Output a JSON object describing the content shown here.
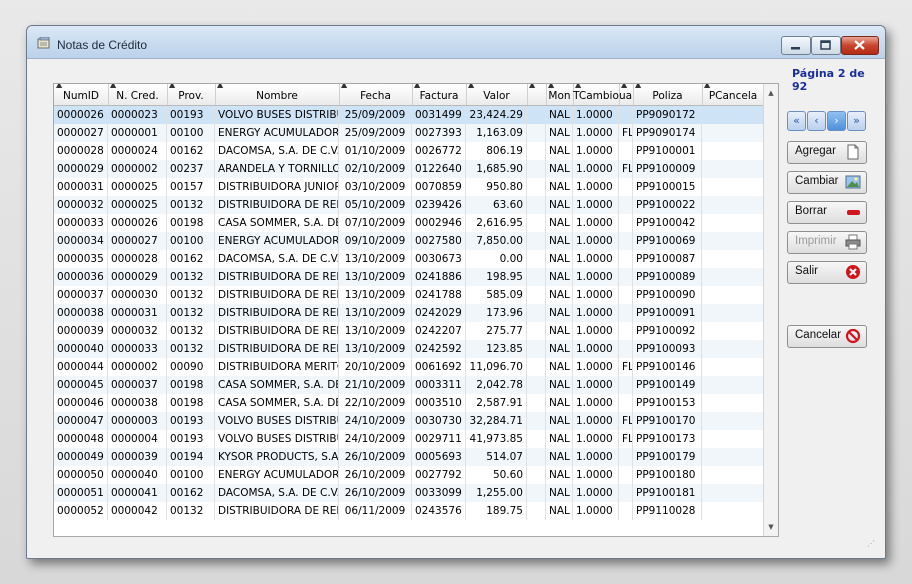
{
  "window": {
    "title": "Notas de Crédito",
    "minimize_icon": "minimize-icon",
    "maximize_icon": "maximize-icon",
    "close_icon": "close-icon"
  },
  "pager": {
    "label": "Página 2 de 92",
    "first_icon": "double-chevron-left-icon",
    "prev_icon": "chevron-left-icon",
    "next_icon": "chevron-right-icon",
    "last_icon": "double-chevron-right-icon"
  },
  "actions": {
    "agregar": {
      "label": "Agregar",
      "icon": "new-document-icon"
    },
    "cambiar": {
      "label": "Cambiar",
      "icon": "edit-picture-icon"
    },
    "borrar": {
      "label": "Borrar",
      "icon": "minus-icon",
      "color": "#d2141b"
    },
    "imprimir": {
      "label": "Imprimir",
      "icon": "printer-icon"
    },
    "salir": {
      "label": "Salir",
      "icon": "exit-x-icon",
      "color": "#d2141b"
    },
    "cancelar": {
      "label": "Cancelar",
      "icon": "cancel-icon",
      "color": "#d2141b"
    }
  },
  "table": {
    "columns": [
      "NumID",
      "N. Cred.",
      "Prov.",
      "Nombre",
      "Fecha",
      "Factura",
      "Valor",
      "",
      "Mon",
      "TCambio",
      "uai",
      "Poliza",
      "PCancela"
    ],
    "rows": [
      [
        "0000026",
        "0000023",
        "00193",
        "VOLVO BUSES DISTRIBUI",
        "25/09/2009",
        "0031499",
        "23,424.29",
        "",
        "NAL",
        "1.0000",
        "",
        "PP9090172",
        ""
      ],
      [
        "0000027",
        "0000001",
        "00100",
        "ENERGY ACUMULADORES",
        "25/09/2009",
        "0027393",
        "1,163.09",
        "",
        "NAL",
        "1.0000",
        "FL",
        "PP9090174",
        ""
      ],
      [
        "0000028",
        "0000024",
        "00162",
        "DACOMSA, S.A. DE C.V.",
        "01/10/2009",
        "0026772",
        "806.19",
        "",
        "NAL",
        "1.0000",
        "",
        "PP9100001",
        ""
      ],
      [
        "0000029",
        "0000002",
        "00237",
        "ARANDELA Y TORNILLOS",
        "02/10/2009",
        "0122640",
        "1,685.90",
        "",
        "NAL",
        "1.0000",
        "FL",
        "PP9100009",
        ""
      ],
      [
        "0000031",
        "0000025",
        "00157",
        "DISTRIBUIDORA JUNIOR,",
        "03/10/2009",
        "0070859",
        "950.80",
        "",
        "NAL",
        "1.0000",
        "",
        "PP9100015",
        ""
      ],
      [
        "0000032",
        "0000025",
        "00132",
        "DISTRIBUIDORA DE REFA",
        "05/10/2009",
        "0239426",
        "63.60",
        "",
        "NAL",
        "1.0000",
        "",
        "PP9100022",
        ""
      ],
      [
        "0000033",
        "0000026",
        "00198",
        "CASA SOMMER, S.A. DE C",
        "07/10/2009",
        "0002946",
        "2,616.95",
        "",
        "NAL",
        "1.0000",
        "",
        "PP9100042",
        ""
      ],
      [
        "0000034",
        "0000027",
        "00100",
        "ENERGY ACUMULADORES",
        "09/10/2009",
        "0027580",
        "7,850.00",
        "",
        "NAL",
        "1.0000",
        "",
        "PP9100069",
        ""
      ],
      [
        "0000035",
        "0000028",
        "00162",
        "DACOMSA, S.A. DE C.V.",
        "13/10/2009",
        "0030673",
        "0.00",
        "",
        "NAL",
        "1.0000",
        "",
        "PP9100087",
        ""
      ],
      [
        "0000036",
        "0000029",
        "00132",
        "DISTRIBUIDORA DE REFA",
        "13/10/2009",
        "0241886",
        "198.95",
        "",
        "NAL",
        "1.0000",
        "",
        "PP9100089",
        ""
      ],
      [
        "0000037",
        "0000030",
        "00132",
        "DISTRIBUIDORA DE REFA",
        "13/10/2009",
        "0241788",
        "585.09",
        "",
        "NAL",
        "1.0000",
        "",
        "PP9100090",
        ""
      ],
      [
        "0000038",
        "0000031",
        "00132",
        "DISTRIBUIDORA DE REFA",
        "13/10/2009",
        "0242029",
        "173.96",
        "",
        "NAL",
        "1.0000",
        "",
        "PP9100091",
        ""
      ],
      [
        "0000039",
        "0000032",
        "00132",
        "DISTRIBUIDORA DE REFA",
        "13/10/2009",
        "0242207",
        "275.77",
        "",
        "NAL",
        "1.0000",
        "",
        "PP9100092",
        ""
      ],
      [
        "0000040",
        "0000033",
        "00132",
        "DISTRIBUIDORA DE REFA",
        "13/10/2009",
        "0242592",
        "123.85",
        "",
        "NAL",
        "1.0000",
        "",
        "PP9100093",
        ""
      ],
      [
        "0000044",
        "0000002",
        "00090",
        "DISTRIBUIDORA MERITOR",
        "20/10/2009",
        "0061692",
        "11,096.70",
        "",
        "NAL",
        "1.0000",
        "FL",
        "PP9100146",
        ""
      ],
      [
        "0000045",
        "0000037",
        "00198",
        "CASA SOMMER, S.A. DE C",
        "21/10/2009",
        "0003311",
        "2,042.78",
        "",
        "NAL",
        "1.0000",
        "",
        "PP9100149",
        ""
      ],
      [
        "0000046",
        "0000038",
        "00198",
        "CASA SOMMER, S.A. DE C",
        "22/10/2009",
        "0003510",
        "2,587.91",
        "",
        "NAL",
        "1.0000",
        "",
        "PP9100153",
        ""
      ],
      [
        "0000047",
        "0000003",
        "00193",
        "VOLVO BUSES DISTRIBUI",
        "24/10/2009",
        "0030730",
        "32,284.71",
        "",
        "NAL",
        "1.0000",
        "FL",
        "PP9100170",
        ""
      ],
      [
        "0000048",
        "0000004",
        "00193",
        "VOLVO BUSES DISTRIBUI",
        "24/10/2009",
        "0029711",
        "41,973.85",
        "",
        "NAL",
        "1.0000",
        "FL",
        "PP9100173",
        ""
      ],
      [
        "0000049",
        "0000039",
        "00194",
        "KYSOR PRODUCTS, S.A. I",
        "26/10/2009",
        "0005693",
        "514.07",
        "",
        "NAL",
        "1.0000",
        "",
        "PP9100179",
        ""
      ],
      [
        "0000050",
        "0000040",
        "00100",
        "ENERGY ACUMULADORES",
        "26/10/2009",
        "0027792",
        "50.60",
        "",
        "NAL",
        "1.0000",
        "",
        "PP9100180",
        ""
      ],
      [
        "0000051",
        "0000041",
        "00162",
        "DACOMSA, S.A. DE C.V.",
        "26/10/2009",
        "0033099",
        "1,255.00",
        "",
        "NAL",
        "1.0000",
        "",
        "PP9100181",
        ""
      ],
      [
        "0000052",
        "0000042",
        "00132",
        "DISTRIBUIDORA DE REFA",
        "06/11/2009",
        "0243576",
        "189.75",
        "",
        "NAL",
        "1.0000",
        "",
        "PP9110028",
        ""
      ]
    ]
  }
}
